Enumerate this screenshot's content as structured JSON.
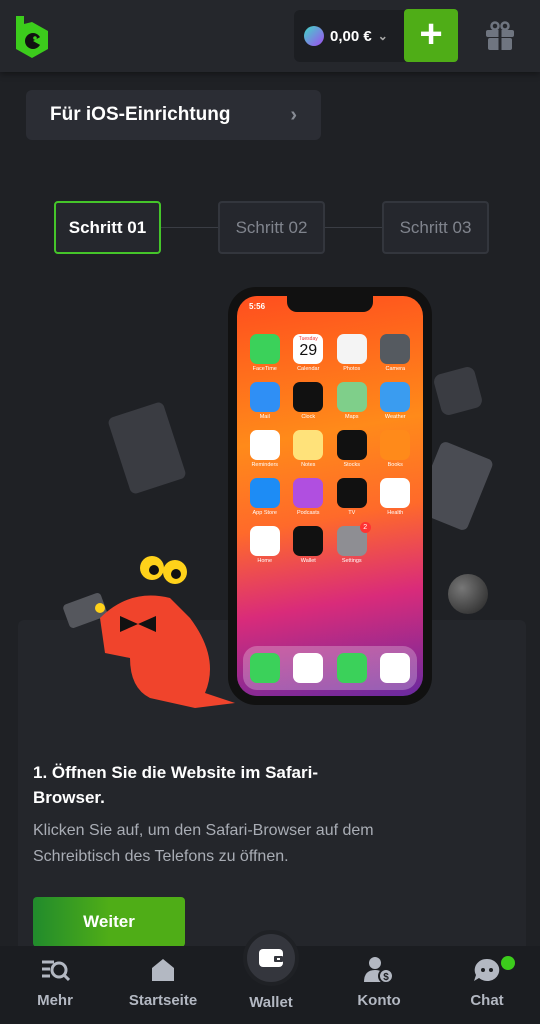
{
  "header": {
    "balance": "0,00 €",
    "add_label": "+",
    "icons": [
      "logo",
      "solana-coin-icon",
      "chevron-down-icon",
      "plus-icon",
      "gift-icon"
    ]
  },
  "setup": {
    "label": "Für iOS-Einrichtung"
  },
  "steps": [
    "Schritt 01",
    "Schritt 02",
    "Schritt 03"
  ],
  "phone": {
    "time": "5:56",
    "calendar_day": "Tuesday",
    "calendar_date": "29",
    "settings_badge": "2",
    "apps": [
      {
        "name": "FaceTime",
        "color": "#3bd15a"
      },
      {
        "name": "Calendar",
        "color": "#ffffff"
      },
      {
        "name": "Photos",
        "color": "#f4f4f4"
      },
      {
        "name": "Camera",
        "color": "#555a60"
      },
      {
        "name": "Mail",
        "color": "#2f8ff5"
      },
      {
        "name": "Clock",
        "color": "#111111"
      },
      {
        "name": "Maps",
        "color": "#7fcf8a"
      },
      {
        "name": "Weather",
        "color": "#3a9cf0"
      },
      {
        "name": "Reminders",
        "color": "#ffffff"
      },
      {
        "name": "Notes",
        "color": "#ffe27a"
      },
      {
        "name": "Stocks",
        "color": "#111111"
      },
      {
        "name": "Books",
        "color": "#ff8a1a"
      },
      {
        "name": "App Store",
        "color": "#1d8cf5"
      },
      {
        "name": "Podcasts",
        "color": "#b04fe0"
      },
      {
        "name": "TV",
        "color": "#111111"
      },
      {
        "name": "Health",
        "color": "#ffffff"
      },
      {
        "name": "Home",
        "color": "#ffffff"
      },
      {
        "name": "Wallet",
        "color": "#111111"
      },
      {
        "name": "Settings",
        "color": "#8e8e93"
      }
    ],
    "dock": [
      {
        "name": "Phone",
        "color": "#3bd15a"
      },
      {
        "name": "Safari",
        "color": "#ffffff"
      },
      {
        "name": "Messages",
        "color": "#3bd15a"
      },
      {
        "name": "Music",
        "color": "#ffffff"
      }
    ]
  },
  "instruction": {
    "title": "1. Öffnen Sie die Website im Safari-Browser.",
    "description": "Klicken Sie auf, um den Safari-Browser auf dem Schreibtisch des Telefons zu öffnen.",
    "button": "Weiter"
  },
  "nav": [
    {
      "label": "Mehr",
      "icon": "menu-search-icon"
    },
    {
      "label": "Startseite",
      "icon": "home-icon"
    },
    {
      "label": "Wallet",
      "icon": "wallet-icon"
    },
    {
      "label": "Konto",
      "icon": "account-icon"
    },
    {
      "label": "Chat",
      "icon": "chat-icon"
    }
  ],
  "colors": {
    "accent": "#4fad17",
    "active_step_border": "#45c52a",
    "chat_badge": "#3ccc1c"
  }
}
